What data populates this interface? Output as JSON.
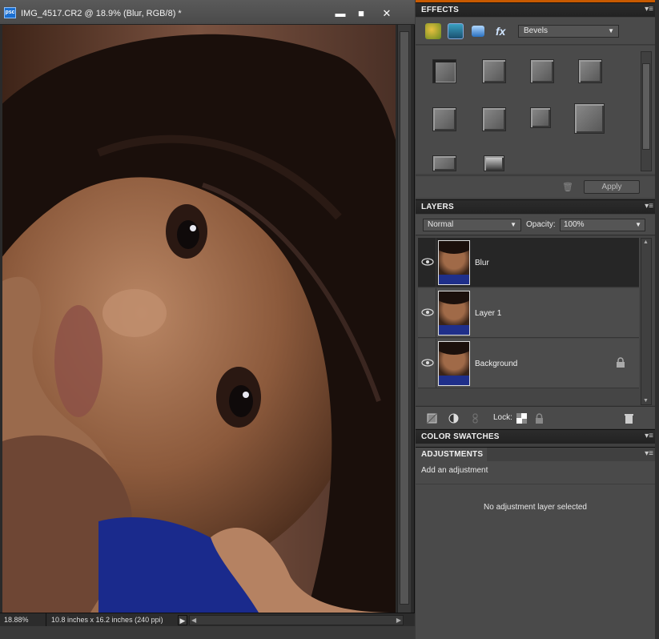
{
  "document": {
    "app_badge": "psc",
    "title": "IMG_4517.CR2 @ 18.9% (Blur, RGB/8) *",
    "window_controls": {
      "minimize": "▬",
      "maximize": "■",
      "close": "✕"
    },
    "zoom": "18.88%",
    "doc_size": "10.8 inches x 16.2 inches (240 ppi)"
  },
  "effects": {
    "title": "EFFECTS",
    "category": "Bevels",
    "tools": [
      "layer-styles-icon",
      "photo-effects-icon",
      "filters-icon",
      "fx-icon"
    ],
    "apply_label": "Apply"
  },
  "layers": {
    "title": "LAYERS",
    "blend_mode": "Normal",
    "opacity_label": "Opacity:",
    "opacity_value": "100%",
    "items": [
      {
        "name": "Blur",
        "selected": true,
        "locked": false
      },
      {
        "name": "Layer 1",
        "selected": false,
        "locked": false
      },
      {
        "name": "Background",
        "selected": false,
        "locked": true
      }
    ],
    "lock_label": "Lock:"
  },
  "color_swatches": {
    "title": "COLOR SWATCHES"
  },
  "adjustments": {
    "title": "ADJUSTMENTS",
    "add_label": "Add an adjustment",
    "empty_message": "No adjustment layer selected"
  },
  "colors": {
    "accent": "#c85a00",
    "selected_layer": "#262626",
    "panel_bg": "#4a4a4a",
    "header_bg": "#222222"
  }
}
